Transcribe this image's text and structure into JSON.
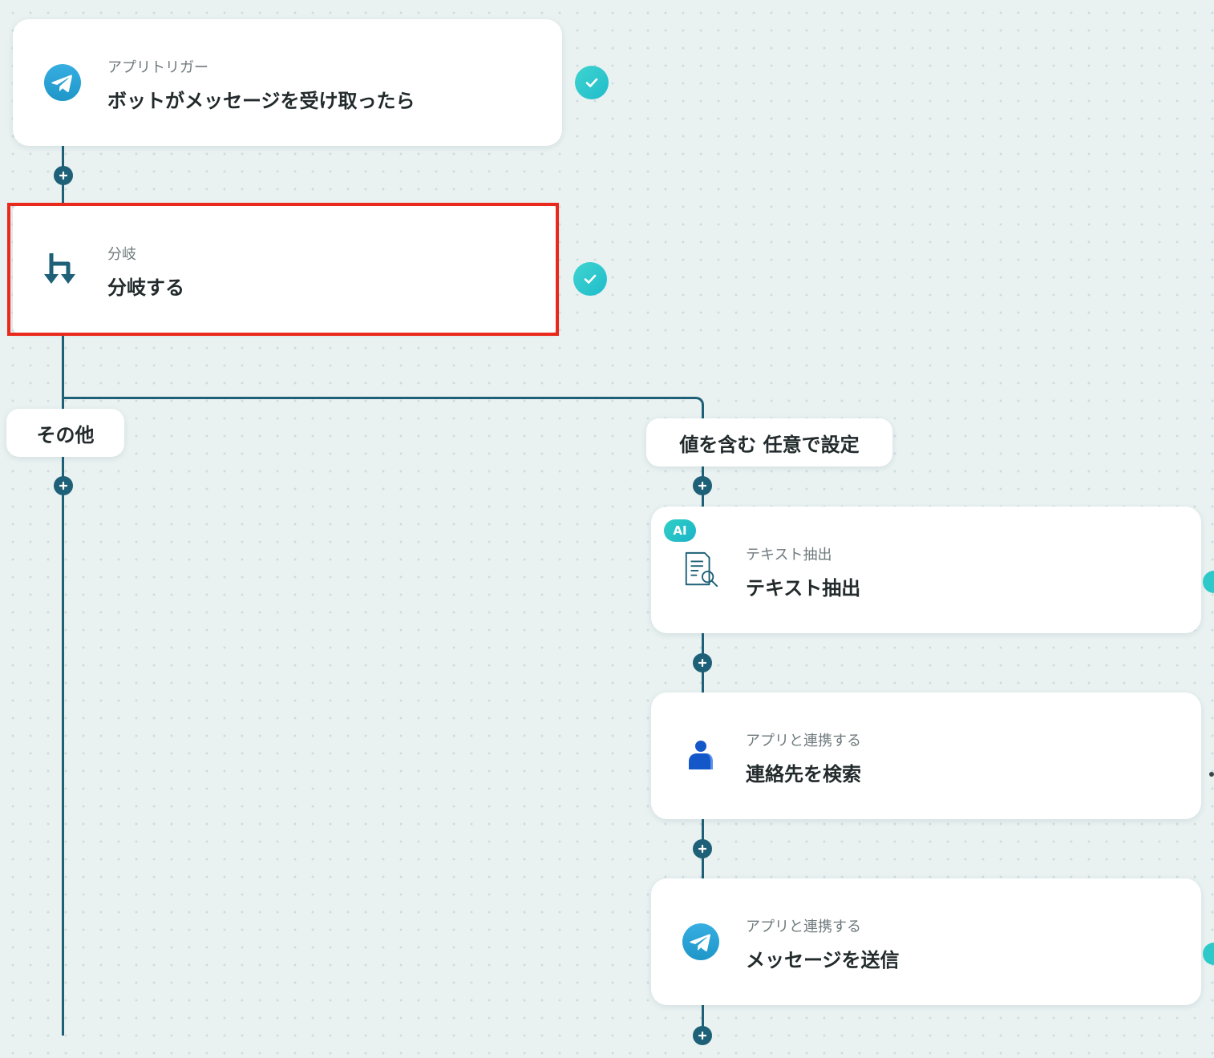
{
  "flow": {
    "trigger": {
      "label": "アプリトリガー",
      "title": "ボットがメッセージを受け取ったら",
      "icon": "telegram-icon",
      "completed": true
    },
    "branch": {
      "label": "分岐",
      "title": "分岐する",
      "icon": "branch-icon",
      "completed": true,
      "highlight_color": "#e8291b"
    },
    "branches": {
      "left_label": "その他",
      "right_label": "値を含む 任意で設定"
    },
    "steps": [
      {
        "badge": "AI",
        "label": "テキスト抽出",
        "title": "テキスト抽出",
        "icon": "document-search-icon"
      },
      {
        "label": "アプリと連携する",
        "title": "連絡先を検索",
        "icon": "contact-person-icon"
      },
      {
        "label": "アプリと連携する",
        "title": "メッセージを送信",
        "icon": "telegram-icon"
      }
    ]
  },
  "colors": {
    "background": "#e9f1f1",
    "connector": "#1d6077",
    "check": "#2cc8cc",
    "highlight": "#e8291b"
  }
}
